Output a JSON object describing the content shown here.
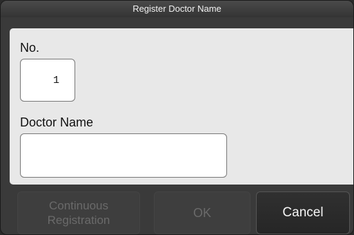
{
  "dialog": {
    "title": "Register Doctor Name"
  },
  "form": {
    "no_label": "No.",
    "no_value": "1",
    "doctor_name_label": "Doctor Name",
    "doctor_name_value": ""
  },
  "buttons": {
    "continuous_line1": "Continuous",
    "continuous_line2": "Registration",
    "ok_label": "OK",
    "cancel_label": "Cancel"
  },
  "colors": {
    "content_bg": "#e8e8e8",
    "dialog_bg": "#3a3a3a",
    "disabled_text": "#6a6a6a"
  }
}
